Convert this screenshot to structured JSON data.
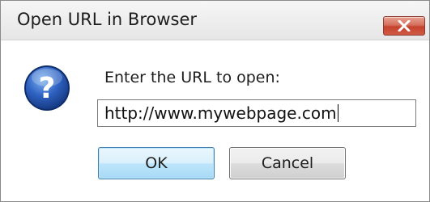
{
  "dialog": {
    "title": "Open URL in Browser",
    "close_icon": "close-x-icon",
    "prompt": "Enter the URL to open:",
    "question_icon": "question-mark-icon",
    "url_input": {
      "value": "http://www.mywebpage.com",
      "placeholder": ""
    },
    "ok_label": "OK",
    "cancel_label": "Cancel"
  },
  "colors": {
    "close_button": "#c5432e",
    "ok_border": "#3c7fb1",
    "question_icon_blue": "#1f4fa8"
  }
}
